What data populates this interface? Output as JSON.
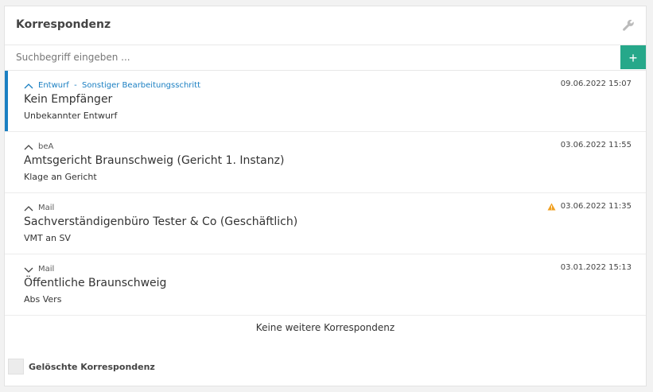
{
  "panel": {
    "title": "Korrespondenz",
    "settings_icon": "wrench-icon"
  },
  "search": {
    "placeholder": "Suchbegriff eingeben ...",
    "value": "",
    "add_label": "+"
  },
  "items": [
    {
      "meta": "Entwurf  -  Sonstiger Bearbeitungsschritt",
      "expanded": true,
      "title": "Kein Empfänger",
      "subtitle": "Unbekannter Entwurf",
      "date": "09.06.2022 15:07",
      "warning": false,
      "active": true
    },
    {
      "meta": "beA",
      "expanded": true,
      "title": "Amtsgericht Braunschweig (Gericht 1. Instanz)",
      "subtitle": "Klage an Gericht",
      "date": "03.06.2022 11:55",
      "warning": false,
      "active": false
    },
    {
      "meta": "Mail",
      "expanded": true,
      "title": "Sachverständigenbüro Tester & Co (Geschäftlich)",
      "subtitle": "VMT an SV",
      "date": "03.06.2022 11:35",
      "warning": true,
      "active": false
    },
    {
      "meta": "Mail",
      "expanded": false,
      "title": "Öffentliche Braunschweig",
      "subtitle": "Abs Vers",
      "date": "03.01.2022 15:13",
      "warning": false,
      "active": false
    }
  ],
  "footer": {
    "no_more": "Keine weitere Korrespondenz",
    "deleted_label": "Gelöschte Korrespondenz"
  },
  "colors": {
    "accent": "#1a7fc2",
    "add_button": "#26a88a",
    "warning": "#f0a020"
  }
}
